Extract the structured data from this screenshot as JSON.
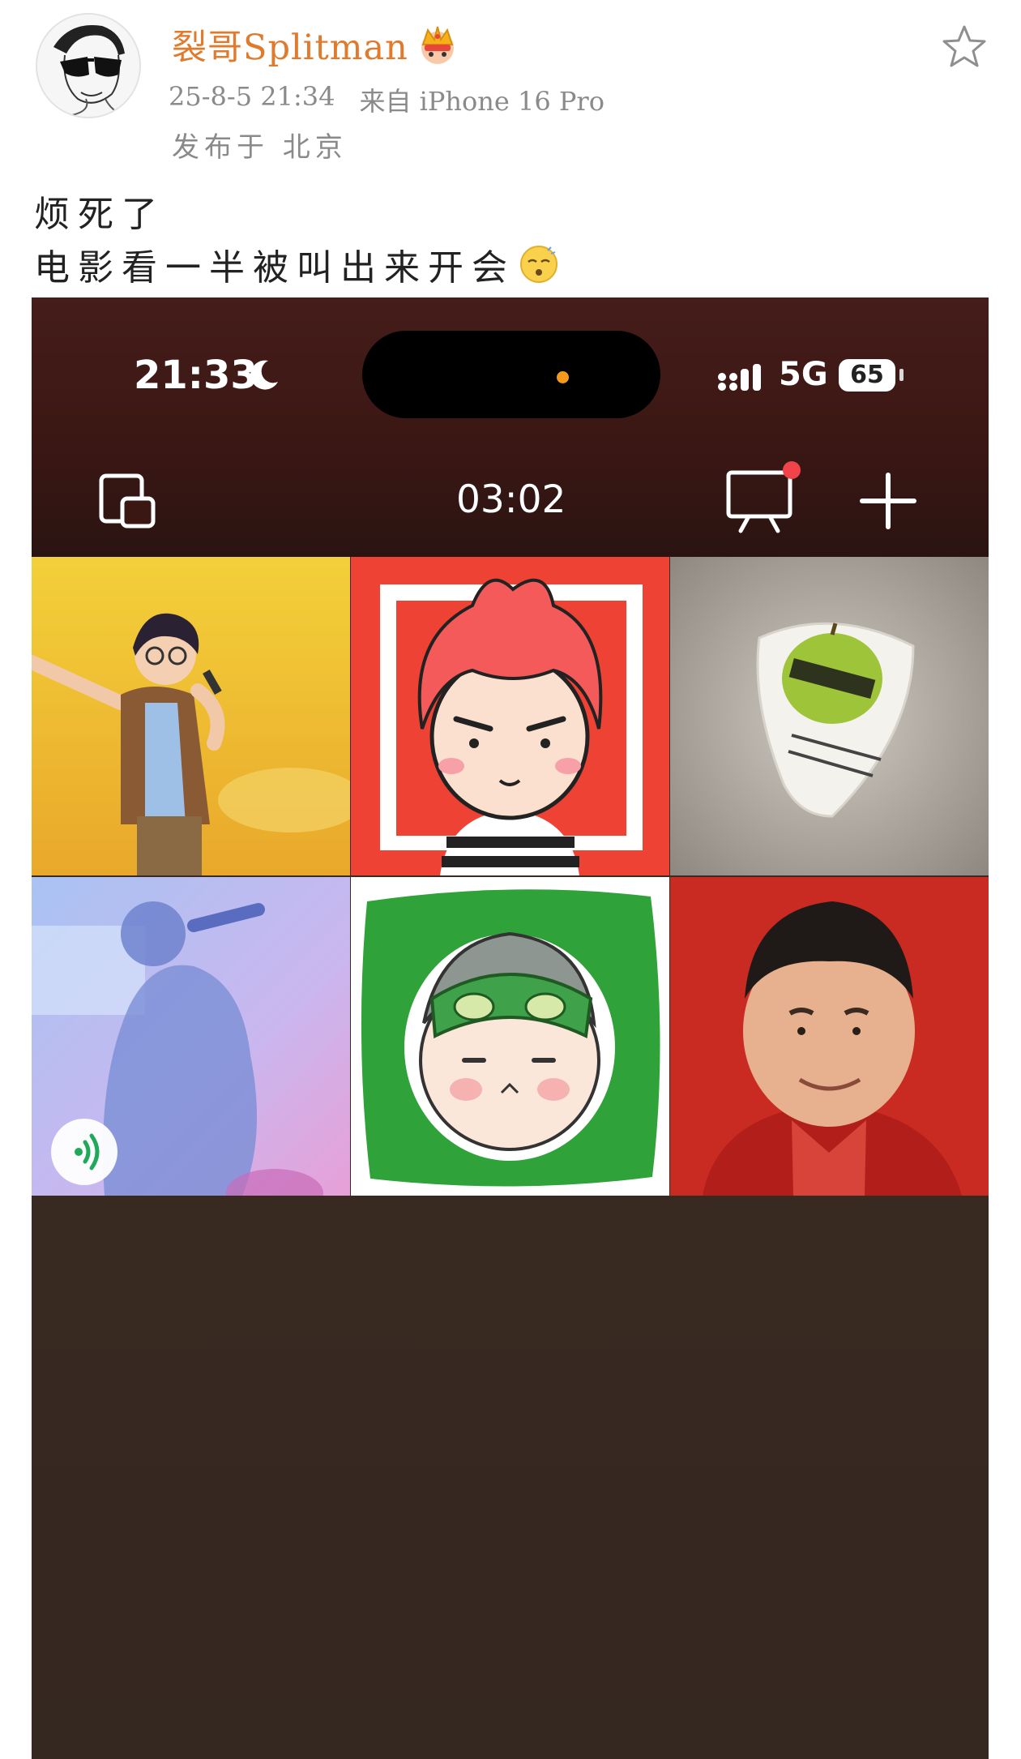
{
  "post": {
    "author": "裂哥Splitman",
    "timestamp": "25-8-5 21:34",
    "source": "来自 iPhone 16 Pro",
    "location": "发布于 北京",
    "lines": [
      "烦死了",
      "电影看一半被叫出来开会"
    ]
  },
  "icons": {
    "avatar": "sunglasses-man-avatar",
    "crown": "crown-badge-icon",
    "favorite": "star-outline-icon",
    "emoji": "dizzy-face-emoji"
  },
  "screenshot": {
    "status_bar": {
      "time": "21:33",
      "network": "5G",
      "battery": "65"
    },
    "meeting": {
      "timer": "03:02"
    },
    "tiles": [
      "singer-cartoon-avatar",
      "red-hair-cartoon-avatar",
      "beatles-guitar-pick-photo",
      "concert-singer-photo",
      "pepe-hat-cartoon-avatar",
      "man-red-background-photo"
    ]
  },
  "colors": {
    "author": "#e07a2c",
    "meta": "#8a8a8a",
    "meeting_bar": "#3b1714",
    "meeting_bg": "#3a2a22"
  }
}
